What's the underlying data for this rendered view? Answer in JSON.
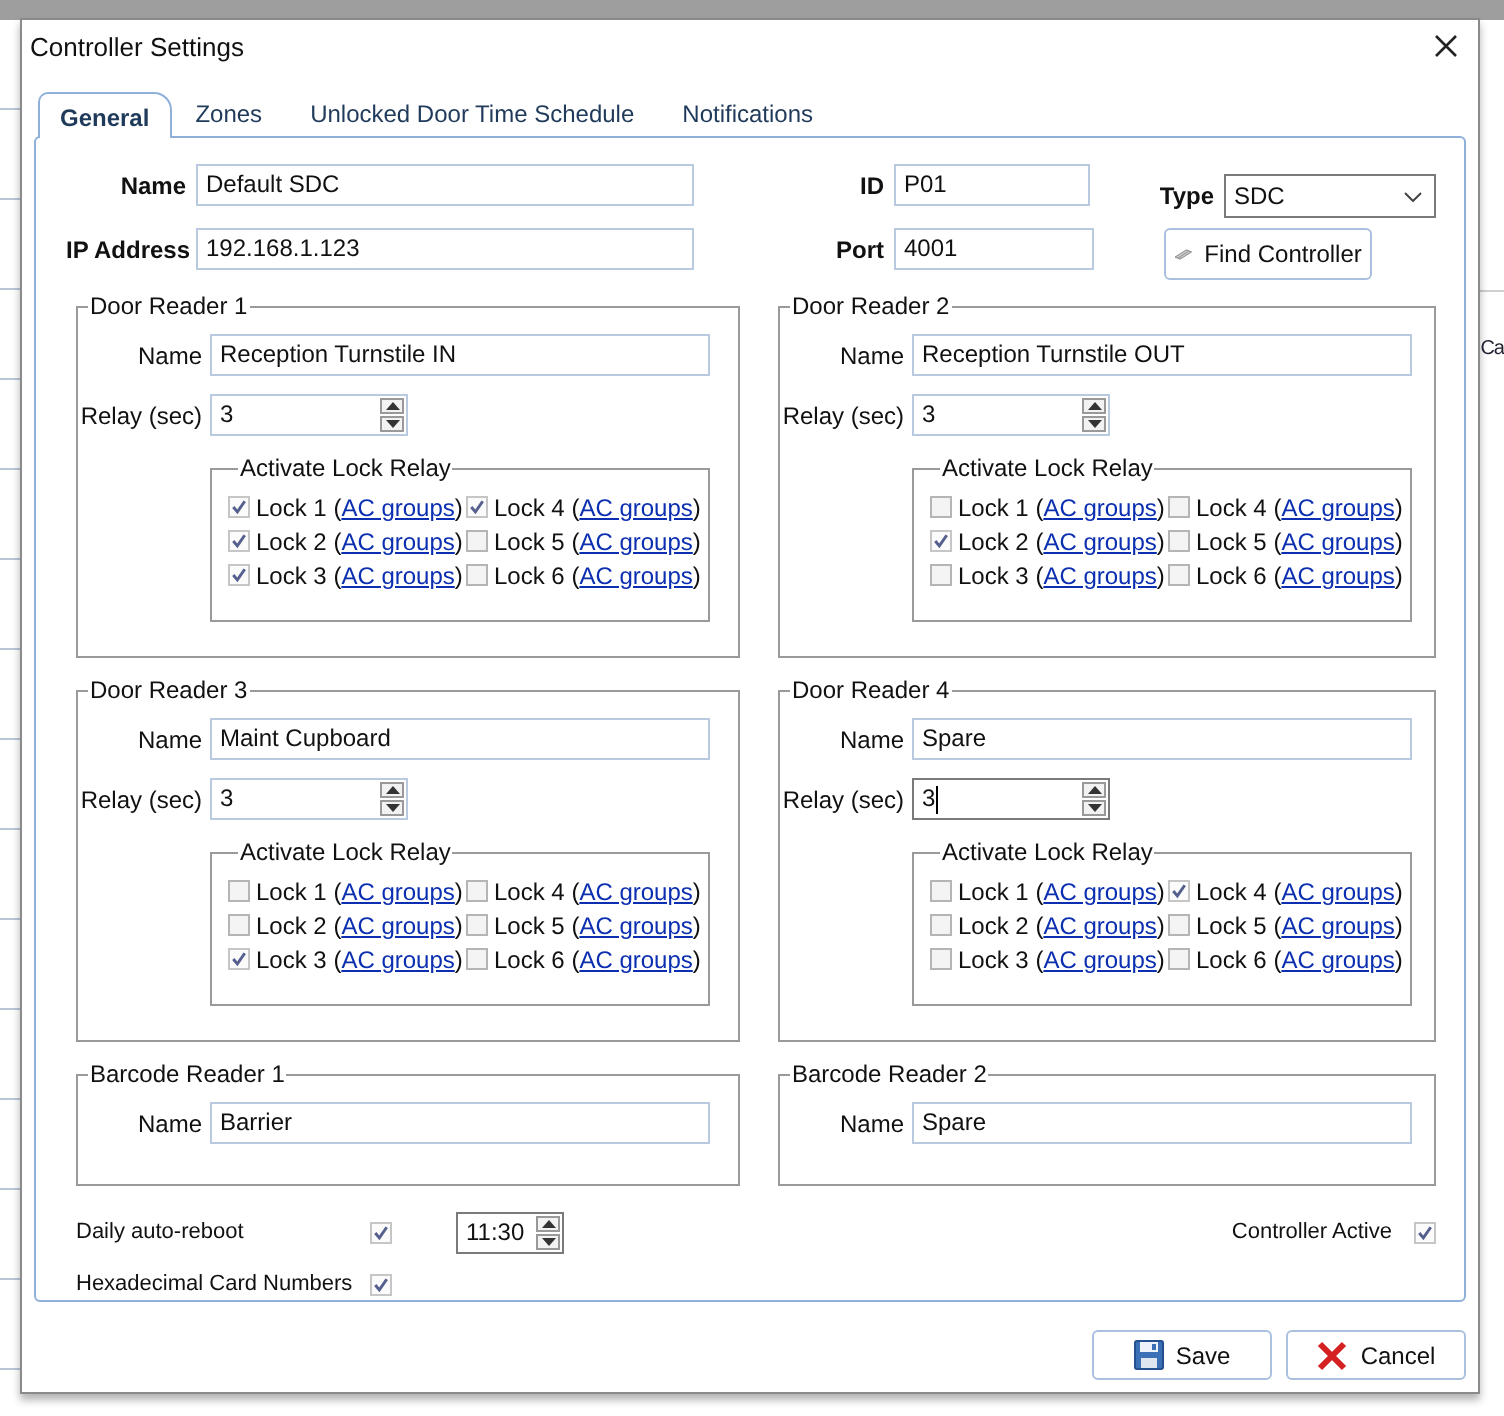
{
  "background": {
    "texts": [
      "Ca"
    ]
  },
  "window": {
    "title": "Controller Settings"
  },
  "tabs": [
    {
      "label": "General",
      "selected": true
    },
    {
      "label": "Zones",
      "selected": false
    },
    {
      "label": "Unlocked Door Time Schedule",
      "selected": false
    },
    {
      "label": "Notifications",
      "selected": false
    }
  ],
  "general": {
    "name": {
      "label": "Name",
      "value": "Default SDC"
    },
    "ip_address": {
      "label": "IP Address",
      "value": "192.168.1.123"
    },
    "id": {
      "label": "ID",
      "value": "P01"
    },
    "port": {
      "label": "Port",
      "value": "4001"
    },
    "type": {
      "label": "Type",
      "value": "SDC"
    },
    "find_button": "Find Controller"
  },
  "door_readers": [
    {
      "title": "Door Reader 1",
      "name_label": "Name",
      "name": "Reception Turnstile IN",
      "relay_label": "Relay (sec)",
      "relay": "3",
      "relay_focused": false,
      "lock_title": "Activate Lock Relay",
      "locks": [
        {
          "label": "Lock 1 (",
          "link": "AC groups",
          "close": ")",
          "checked": true
        },
        {
          "label": "Lock 2 (",
          "link": "AC groups",
          "close": ")",
          "checked": true
        },
        {
          "label": "Lock 3 (",
          "link": "AC groups",
          "close": ")",
          "checked": true
        },
        {
          "label": "Lock 4 (",
          "link": "AC groups",
          "close": ")",
          "checked": true
        },
        {
          "label": "Lock 5 (",
          "link": "AC groups",
          "close": ")",
          "checked": false
        },
        {
          "label": "Lock 6 (",
          "link": "AC groups",
          "close": ")",
          "checked": false
        }
      ]
    },
    {
      "title": "Door Reader 2",
      "name_label": "Name",
      "name": "Reception Turnstile OUT",
      "relay_label": "Relay (sec)",
      "relay": "3",
      "relay_focused": false,
      "lock_title": "Activate Lock Relay",
      "locks": [
        {
          "label": "Lock 1 (",
          "link": "AC groups",
          "close": ")",
          "checked": false
        },
        {
          "label": "Lock 2 (",
          "link": "AC groups",
          "close": ")",
          "checked": true
        },
        {
          "label": "Lock 3 (",
          "link": "AC groups",
          "close": ")",
          "checked": false
        },
        {
          "label": "Lock 4 (",
          "link": "AC groups",
          "close": ")",
          "checked": false
        },
        {
          "label": "Lock 5 (",
          "link": "AC groups",
          "close": ")",
          "checked": false
        },
        {
          "label": "Lock 6 (",
          "link": "AC groups",
          "close": ")",
          "checked": false
        }
      ]
    },
    {
      "title": "Door Reader 3",
      "name_label": "Name",
      "name": "Maint Cupboard",
      "relay_label": "Relay (sec)",
      "relay": "3",
      "relay_focused": false,
      "lock_title": "Activate Lock Relay",
      "locks": [
        {
          "label": "Lock 1 (",
          "link": "AC groups",
          "close": ")",
          "checked": false
        },
        {
          "label": "Lock 2 (",
          "link": "AC groups",
          "close": ")",
          "checked": false
        },
        {
          "label": "Lock 3 (",
          "link": "AC groups",
          "close": ")",
          "checked": true
        },
        {
          "label": "Lock 4 (",
          "link": "AC groups",
          "close": ")",
          "checked": false
        },
        {
          "label": "Lock 5 (",
          "link": "AC groups",
          "close": ")",
          "checked": false
        },
        {
          "label": "Lock 6 (",
          "link": "AC groups",
          "close": ")",
          "checked": false
        }
      ]
    },
    {
      "title": "Door Reader 4",
      "name_label": "Name",
      "name": "Spare",
      "relay_label": "Relay (sec)",
      "relay": "3",
      "relay_focused": true,
      "lock_title": "Activate Lock Relay",
      "locks": [
        {
          "label": "Lock 1 (",
          "link": "AC groups",
          "close": ")",
          "checked": false
        },
        {
          "label": "Lock 2 (",
          "link": "AC groups",
          "close": ")",
          "checked": false
        },
        {
          "label": "Lock 3 (",
          "link": "AC groups",
          "close": ")",
          "checked": false
        },
        {
          "label": "Lock 4 (",
          "link": "AC groups",
          "close": ")",
          "checked": true
        },
        {
          "label": "Lock 5 (",
          "link": "AC groups",
          "close": ")",
          "checked": false
        },
        {
          "label": "Lock 6 (",
          "link": "AC groups",
          "close": ")",
          "checked": false
        }
      ]
    }
  ],
  "barcode_readers": [
    {
      "title": "Barcode Reader 1",
      "name_label": "Name",
      "name": "Barrier"
    },
    {
      "title": "Barcode Reader 2",
      "name_label": "Name",
      "name": "Spare"
    }
  ],
  "auto_reboot": {
    "label": "Daily auto-reboot",
    "checked": true,
    "time": "11:30"
  },
  "hex_card_numbers": {
    "label": "Hexadecimal Card Numbers",
    "checked": true
  },
  "controller_active": {
    "label": "Controller Active",
    "checked": true
  },
  "buttons": [
    {
      "label": "Save",
      "kind": "save"
    },
    {
      "label": "Cancel",
      "kind": "cancel"
    }
  ]
}
